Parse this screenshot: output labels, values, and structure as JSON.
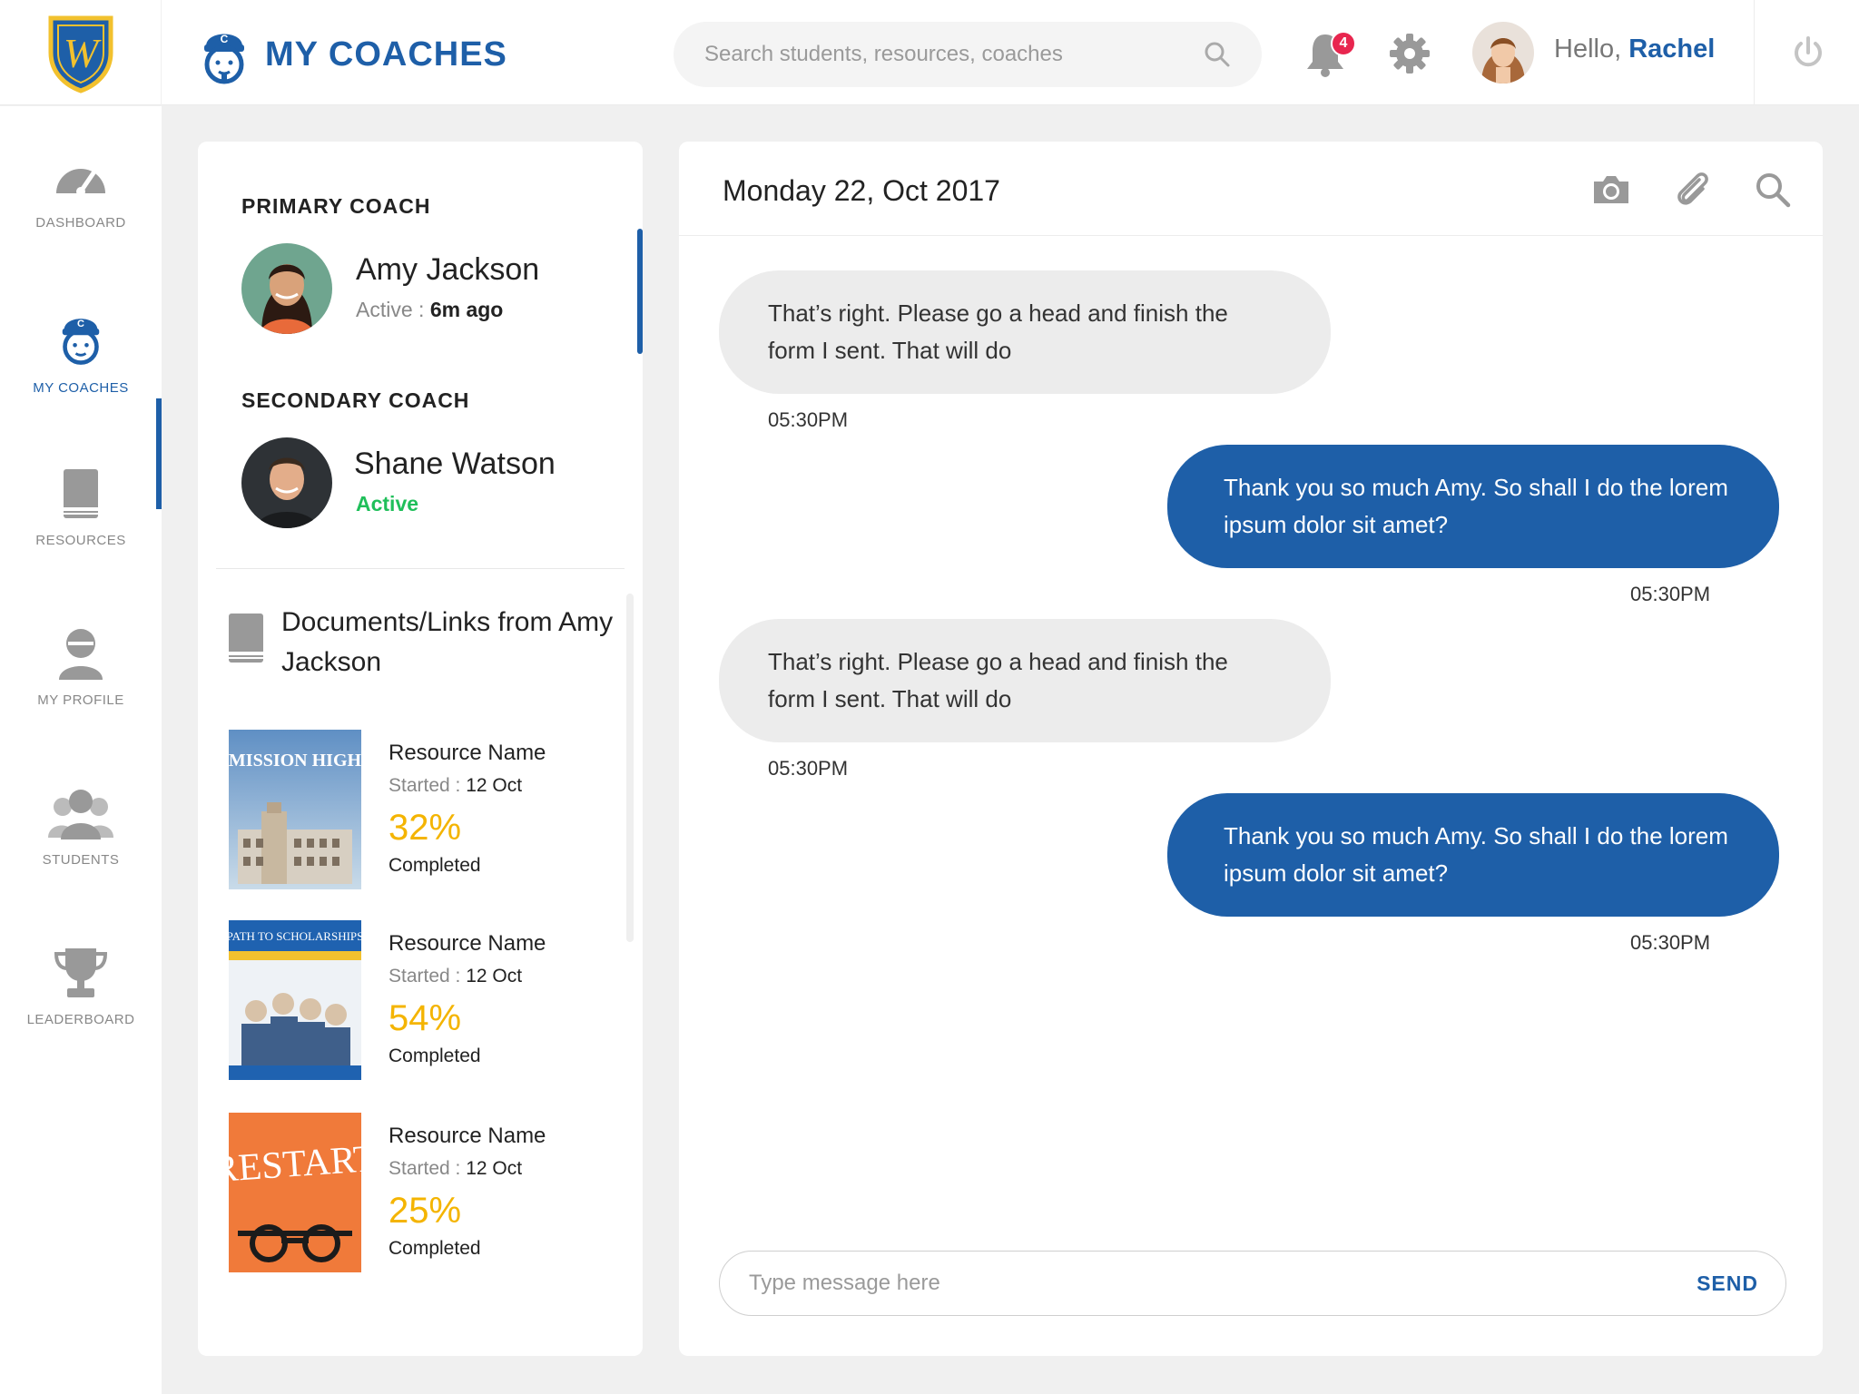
{
  "header": {
    "page_title": "MY COACHES",
    "search_placeholder": "Search students, resources, coaches",
    "notification_count": "4",
    "greeting": "Hello, ",
    "user_name": "Rachel"
  },
  "sidebar": {
    "items": [
      {
        "label": "DASHBOARD",
        "icon": "dashboard-gauge-icon"
      },
      {
        "label": "MY COACHES",
        "icon": "coach-icon",
        "active": true
      },
      {
        "label": "RESOURCES",
        "icon": "book-icon"
      },
      {
        "label": "MY PROFILE",
        "icon": "profile-icon"
      },
      {
        "label": "STUDENTS",
        "icon": "students-icon"
      },
      {
        "label": "LEADERBOARD",
        "icon": "trophy-icon"
      }
    ]
  },
  "coaches": {
    "primary_label": "PRIMARY COACH",
    "primary": {
      "name": "Amy Jackson",
      "status_prefix": "Active : ",
      "status_value": "6m ago"
    },
    "secondary_label": "SECONDARY COACH",
    "secondary": {
      "name": "Shane Watson",
      "status": "Active"
    }
  },
  "documents": {
    "heading": "Documents/Links from Amy Jackson",
    "items": [
      {
        "name": "Resource Name",
        "started_prefix": "Started : ",
        "started": "12 Oct",
        "percent": "32%",
        "status": "Completed",
        "cover_title": "MISSION HIGH"
      },
      {
        "name": "Resource Name",
        "started_prefix": "Started : ",
        "started": "12 Oct",
        "percent": "54%",
        "status": "Completed",
        "cover_title": "PATH TO SCHOLARSHIPS"
      },
      {
        "name": "Resource Name",
        "started_prefix": "Started : ",
        "started": "12 Oct",
        "percent": "25%",
        "status": "Completed",
        "cover_title": "RESTART"
      }
    ]
  },
  "chat": {
    "date": "Monday 22, Oct 2017",
    "messages": [
      {
        "direction": "in",
        "text": "That’s right. Please go a head and finish the form I sent. That will do",
        "time": "05:30PM"
      },
      {
        "direction": "out",
        "text": "Thank you so much Amy. So shall I do the lorem ipsum dolor sit amet?",
        "time": "05:30PM"
      },
      {
        "direction": "in",
        "text": "That’s right. Please go a head and finish the form I sent. That will do",
        "time": "05:30PM"
      },
      {
        "direction": "out",
        "text": "Thank you so much Amy. So shall I do the lorem ipsum dolor sit amet?",
        "time": "05:30PM"
      }
    ],
    "input_placeholder": "Type message here",
    "send_label": "SEND"
  },
  "colors": {
    "brand_blue": "#1e5fa8",
    "active_green": "#1fbf5a",
    "percent_yellow": "#f4b400",
    "badge_red": "#e8264f"
  }
}
